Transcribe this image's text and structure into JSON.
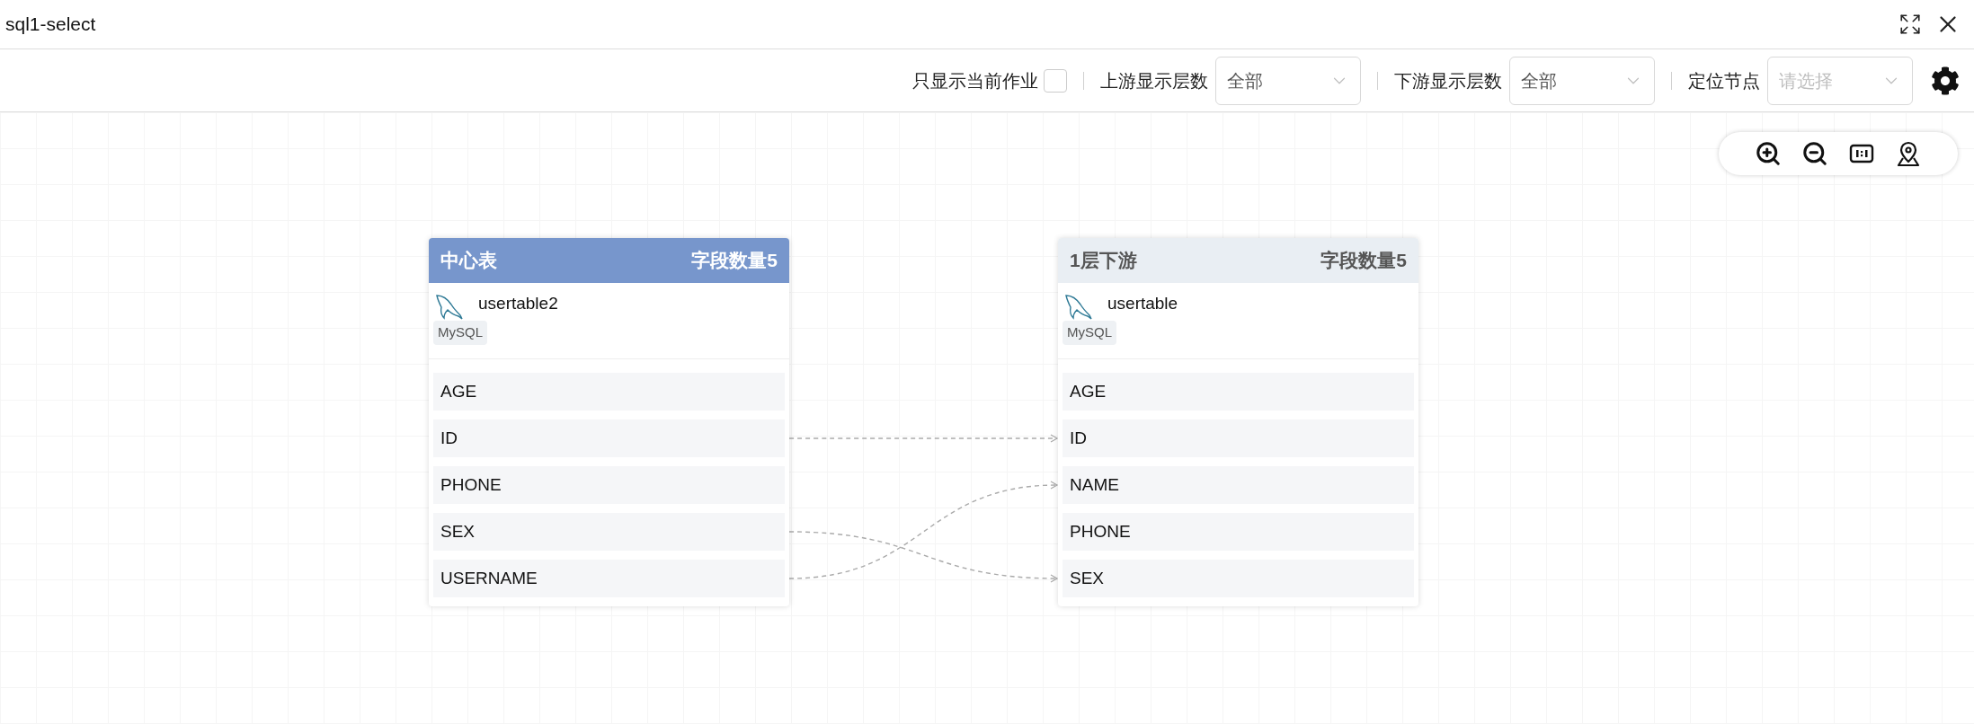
{
  "window": {
    "title": "sql1-select"
  },
  "toolbar": {
    "current_job_only": {
      "label": "只显示当前作业",
      "checked": false
    },
    "upstream_levels": {
      "label": "上游显示层数",
      "value": "全部"
    },
    "downstream_levels": {
      "label": "下游显示层数",
      "value": "全部"
    },
    "locate_node": {
      "label": "定位节点",
      "placeholder": "请选择"
    }
  },
  "tables": [
    {
      "kind": "center",
      "title": "中心表",
      "field_count": "字段数量5",
      "name": "usertable2",
      "db_type": "MySQL",
      "fields": [
        "AGE",
        "ID",
        "PHONE",
        "SEX",
        "USERNAME"
      ],
      "links": [
        {
          "kind": "unlinked"
        },
        {
          "kind": "level"
        },
        {
          "kind": "unlinked"
        },
        {
          "kind": "descending"
        },
        {
          "kind": "ascending"
        }
      ]
    },
    {
      "kind": "downstream",
      "title": "1层下游",
      "field_count": "字段数量5",
      "name": "usertable",
      "db_type": "MySQL",
      "fields": [
        "AGE",
        "ID",
        "NAME",
        "PHONE",
        "SEX"
      ]
    }
  ]
}
